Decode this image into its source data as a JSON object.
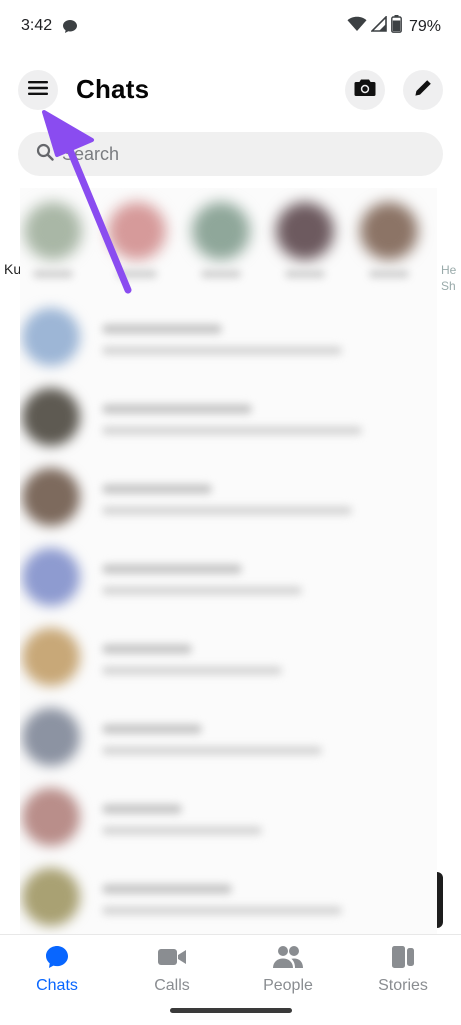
{
  "status_bar": {
    "time": "3:42",
    "battery": "79%"
  },
  "header": {
    "title": "Chats"
  },
  "search": {
    "placeholder": "Search"
  },
  "edge_text": {
    "left": "Ku",
    "right": "He\nSh"
  },
  "bottom_nav": {
    "items": [
      {
        "label": "Chats",
        "icon": "chat-bubble-icon",
        "active": true
      },
      {
        "label": "Calls",
        "icon": "video-camera-icon",
        "active": false
      },
      {
        "label": "People",
        "icon": "people-icon",
        "active": false
      },
      {
        "label": "Stories",
        "icon": "stories-icon",
        "active": false
      }
    ]
  },
  "colors": {
    "accent": "#0866ff",
    "annotation_arrow": "#8a4cf0",
    "inactive": "#8a8d91"
  }
}
